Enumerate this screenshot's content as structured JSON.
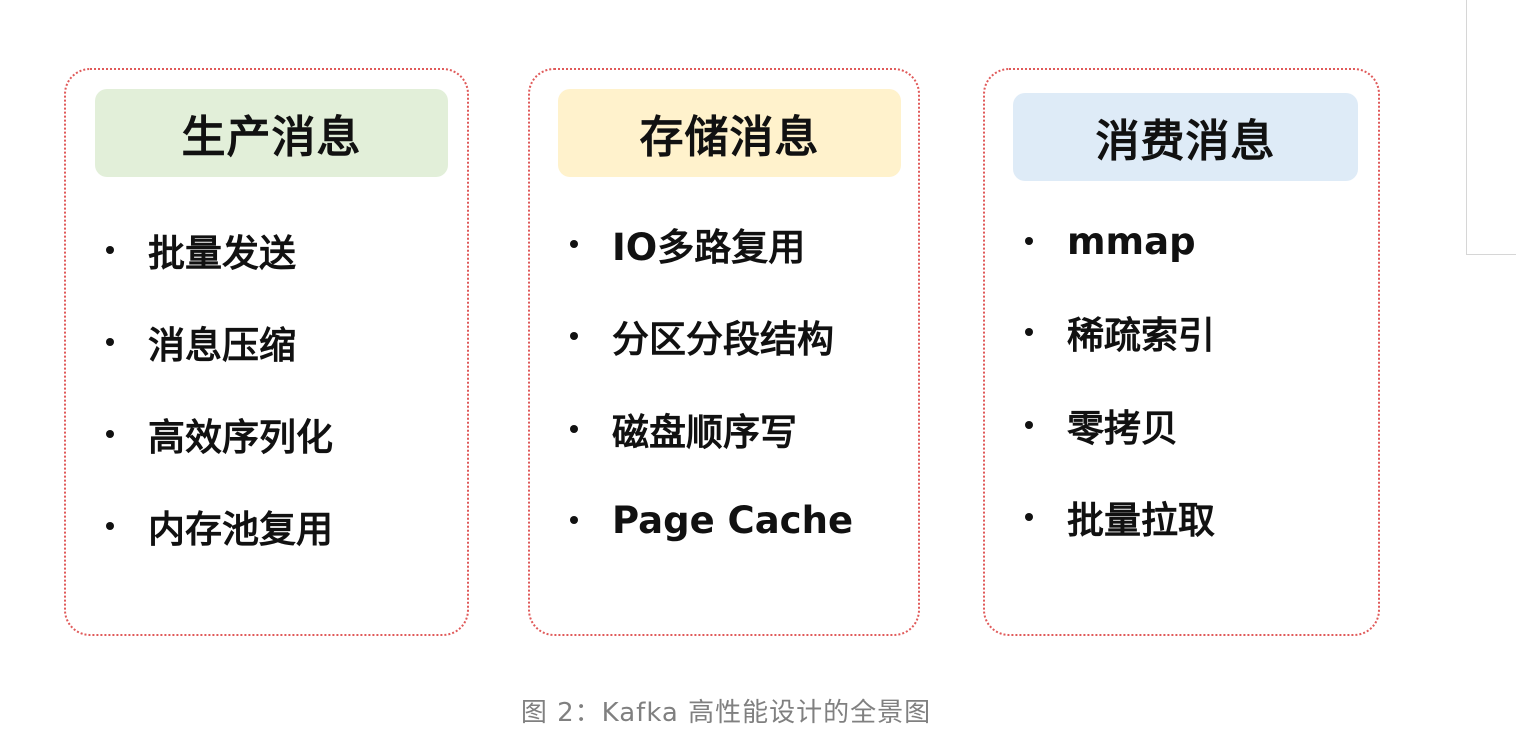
{
  "panels": [
    {
      "title": "生产消息",
      "header_color": "#e2efd9",
      "items": [
        "批量发送",
        "消息压缩",
        "高效序列化",
        "内存池复用"
      ]
    },
    {
      "title": "存储消息",
      "header_color": "#fff2cc",
      "items": [
        "IO多路复用",
        "分区分段结构",
        "磁盘顺序写",
        "Page Cache"
      ]
    },
    {
      "title": "消费消息",
      "header_color": "#deebf7",
      "items": [
        "mmap",
        "稀疏索引",
        "零拷贝",
        "批量拉取"
      ]
    }
  ],
  "panel_border_color": "#e05a5a",
  "caption": "图 2：Kafka 高性能设计的全景图"
}
